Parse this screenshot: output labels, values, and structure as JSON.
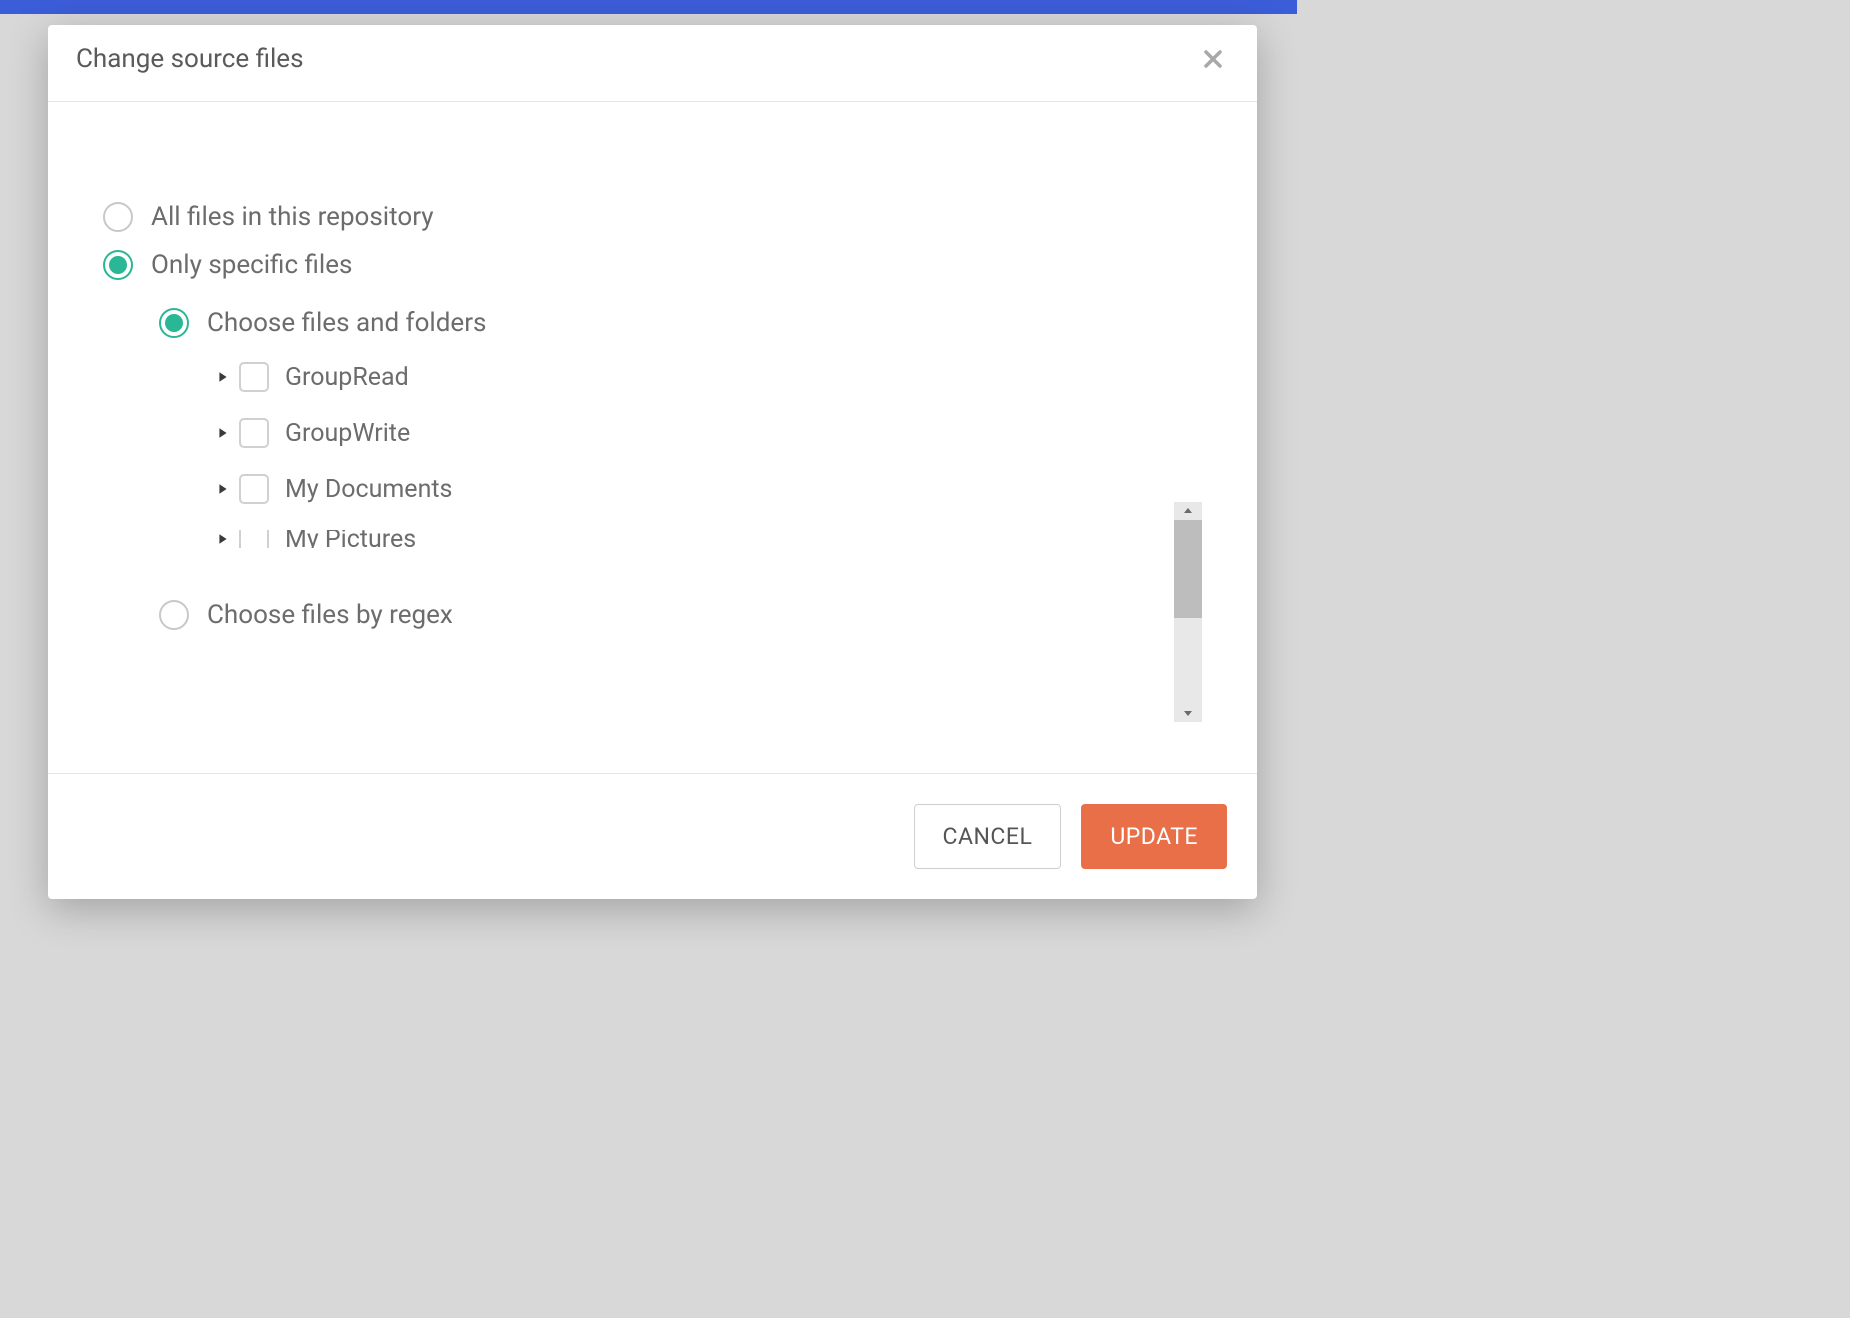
{
  "modal": {
    "title": "Change source files",
    "options": {
      "all_files": "All files in this repository",
      "specific_files": "Only specific files"
    },
    "sub_options": {
      "choose_files": "Choose files and folders",
      "choose_regex": "Choose files by regex"
    },
    "tree": [
      {
        "label": "GroupRead"
      },
      {
        "label": "GroupWrite"
      },
      {
        "label": "My Documents"
      },
      {
        "label": "My Pictures"
      }
    ],
    "buttons": {
      "cancel": "CANCEL",
      "update": "UPDATE"
    }
  }
}
